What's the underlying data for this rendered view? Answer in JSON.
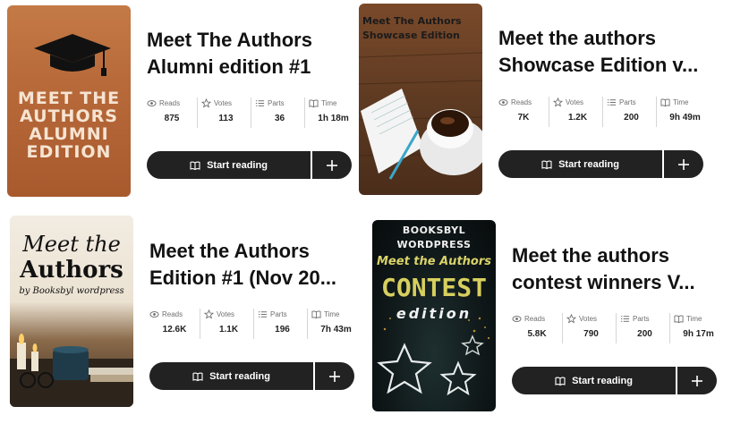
{
  "common": {
    "reads_label": "Reads",
    "votes_label": "Votes",
    "parts_label": "Parts",
    "time_label": "Time",
    "start_label": "Start reading"
  },
  "stories": [
    {
      "title_line1": "Meet The Authors",
      "title_line2": "Alumni edition #1",
      "reads": "875",
      "votes": "113",
      "parts": "36",
      "time": "1h 18m",
      "cover": {
        "lines": [
          "MEET THE",
          "AUTHORS",
          "ALUMNI",
          "EDITION"
        ]
      }
    },
    {
      "title_line1": "Meet the authors",
      "title_line2": "Showcase Edition v...",
      "reads": "7K",
      "votes": "1.2K",
      "parts": "200",
      "time": "9h 49m",
      "cover": {
        "lines": [
          "Meet The Authors",
          "Showcase Edition"
        ]
      }
    },
    {
      "title_line1": "Meet the Authors",
      "title_line2": "Edition #1 (Nov 20...",
      "reads": "12.6K",
      "votes": "1.1K",
      "parts": "196",
      "time": "7h 43m",
      "cover": {
        "lines": [
          "Meet the",
          "Authors",
          "by Booksbyl wordpress"
        ]
      }
    },
    {
      "title_line1": "Meet the authors",
      "title_line2": "contest winners V...",
      "reads": "5.8K",
      "votes": "790",
      "parts": "200",
      "time": "9h 17m",
      "cover": {
        "lines": [
          "BOOKSBYL WORDPRESS",
          "Meet the Authors",
          "CONTEST",
          "edition"
        ]
      }
    }
  ]
}
